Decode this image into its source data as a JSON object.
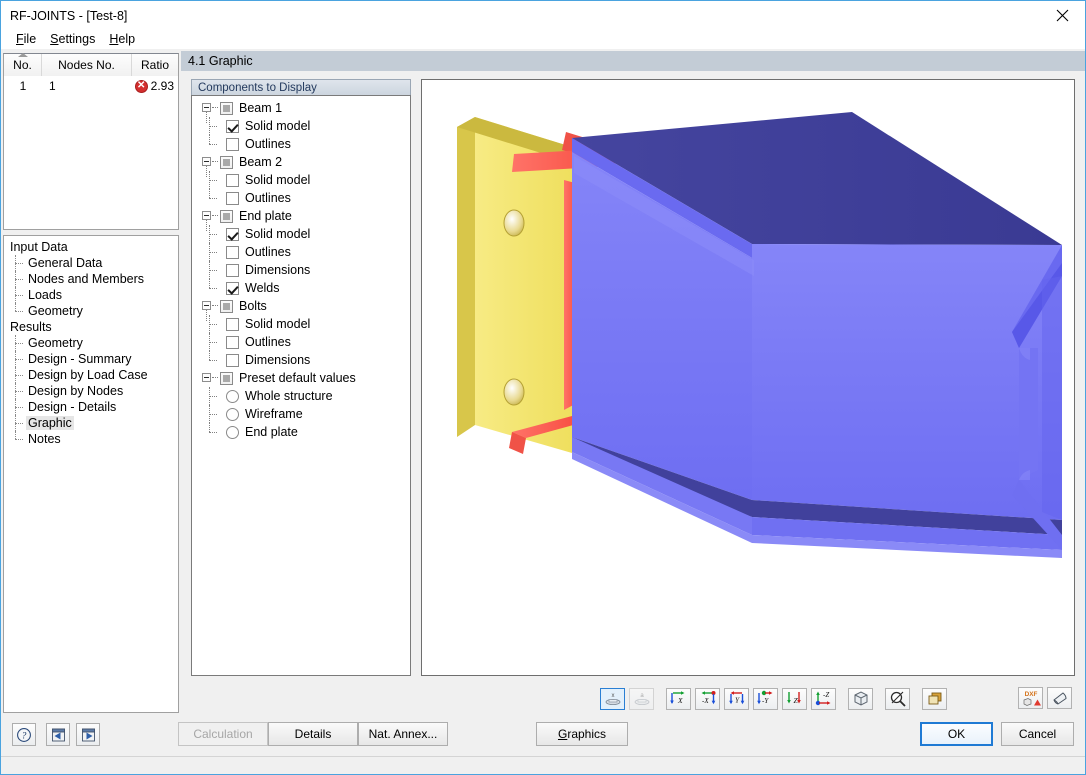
{
  "window": {
    "title": "RF-JOINTS - [Test-8]",
    "close_icon": "close-icon"
  },
  "menu": {
    "items": [
      {
        "label": "File",
        "accel": "F"
      },
      {
        "label": "Settings",
        "accel": "S"
      },
      {
        "label": "Help",
        "accel": "H"
      }
    ]
  },
  "results_table": {
    "columns": [
      "No.",
      "Nodes No.",
      "Ratio"
    ],
    "rows": [
      {
        "no": "1",
        "nodes_no": "1",
        "status_icon": "error-icon",
        "ratio": "2.93"
      }
    ]
  },
  "nav": {
    "groups": [
      {
        "label": "Input Data",
        "items": [
          {
            "label": "General Data",
            "selected": false
          },
          {
            "label": "Nodes and Members",
            "selected": false
          },
          {
            "label": "Loads",
            "selected": false
          },
          {
            "label": "Geometry",
            "selected": false
          }
        ]
      },
      {
        "label": "Results",
        "items": [
          {
            "label": "Geometry",
            "selected": false
          },
          {
            "label": "Design - Summary",
            "selected": false
          },
          {
            "label": "Design by Load Case",
            "selected": false
          },
          {
            "label": "Design by Nodes",
            "selected": false
          },
          {
            "label": "Design - Details",
            "selected": false
          },
          {
            "label": "Graphic",
            "selected": true
          },
          {
            "label": "Notes",
            "selected": false
          }
        ]
      }
    ]
  },
  "section": {
    "header": "4.1 Graphic"
  },
  "components": {
    "caption": "Components to Display",
    "tree": [
      {
        "label": "Beam 1",
        "state": "tristate",
        "children": [
          {
            "label": "Solid model",
            "type": "checkbox",
            "checked": true
          },
          {
            "label": "Outlines",
            "type": "checkbox",
            "checked": false
          }
        ]
      },
      {
        "label": "Beam 2",
        "state": "tristate",
        "children": [
          {
            "label": "Solid model",
            "type": "checkbox",
            "checked": false
          },
          {
            "label": "Outlines",
            "type": "checkbox",
            "checked": false
          }
        ]
      },
      {
        "label": "End plate",
        "state": "tristate",
        "children": [
          {
            "label": "Solid model",
            "type": "checkbox",
            "checked": true
          },
          {
            "label": "Outlines",
            "type": "checkbox",
            "checked": false
          },
          {
            "label": "Dimensions",
            "type": "checkbox",
            "checked": false
          },
          {
            "label": "Welds",
            "type": "checkbox",
            "checked": true
          }
        ]
      },
      {
        "label": "Bolts",
        "state": "tristate",
        "children": [
          {
            "label": "Solid model",
            "type": "checkbox",
            "checked": false
          },
          {
            "label": "Outlines",
            "type": "checkbox",
            "checked": false
          },
          {
            "label": "Dimensions",
            "type": "checkbox",
            "checked": false
          }
        ]
      },
      {
        "label": "Preset default values",
        "state": "tristate",
        "children": [
          {
            "label": "Whole structure",
            "type": "radio",
            "checked": false
          },
          {
            "label": "Wireframe",
            "type": "radio",
            "checked": false
          },
          {
            "label": "End plate",
            "type": "radio",
            "checked": false
          }
        ]
      }
    ]
  },
  "graphics_toolbar": {
    "buttons": [
      {
        "name": "render-solid-button",
        "icon": "solid-view-icon",
        "label": "x",
        "selected": true,
        "disabled": false
      },
      {
        "name": "render-wireframe-button",
        "icon": "wireframe-view-icon",
        "label": "a",
        "selected": false,
        "disabled": true
      },
      {
        "name": "view-x-button",
        "icon": "view-in-x-icon",
        "label": "X",
        "selected": false,
        "disabled": false
      },
      {
        "name": "view-neg-x-button",
        "icon": "view-against-x-icon",
        "label": "-X",
        "selected": false,
        "disabled": false
      },
      {
        "name": "view-y-button",
        "icon": "view-in-y-icon",
        "label": "Y",
        "selected": false,
        "disabled": false
      },
      {
        "name": "view-neg-y-button",
        "icon": "view-against-y-icon",
        "label": "-Y",
        "selected": false,
        "disabled": false
      },
      {
        "name": "view-z-button",
        "icon": "view-in-z-icon",
        "label": "Z",
        "selected": false,
        "disabled": false
      },
      {
        "name": "view-neg-z-button",
        "icon": "view-against-z-icon",
        "label": "-Z",
        "selected": false,
        "disabled": false
      },
      {
        "name": "isometric-view-button",
        "icon": "cube-isometric-icon",
        "label": "",
        "selected": false,
        "disabled": false
      },
      {
        "name": "zoom-all-button",
        "icon": "magnifier-icon",
        "label": "",
        "selected": false,
        "disabled": false
      },
      {
        "name": "render-mode-button",
        "icon": "layers-icon",
        "label": "",
        "selected": false,
        "disabled": false
      }
    ],
    "right_buttons": [
      {
        "name": "export-dxf-button",
        "icon": "dxf-export-icon",
        "label": "DXF"
      },
      {
        "name": "print-button",
        "icon": "printer-icon",
        "label": ""
      }
    ]
  },
  "bottom_bar": {
    "icon_buttons": [
      {
        "name": "help-button",
        "icon": "question-icon"
      },
      {
        "name": "previous-button",
        "icon": "arrow-left-icon"
      },
      {
        "name": "next-button",
        "icon": "arrow-right-icon"
      }
    ],
    "calculation_label": "Calculation",
    "details_label": "Details",
    "nat_annex_label": "Nat. Annex...",
    "graphics_label": "Graphics",
    "graphics_accel": "G",
    "ok_label": "OK",
    "cancel_label": "Cancel"
  },
  "colors": {
    "title_bar_border": "#4aa3df",
    "section_header": "#c3ccd6",
    "beam_face_light": "#7b7bf5",
    "beam_face_dark": "#3d3d9e",
    "end_plate": "#f2e46a",
    "end_plate_edge": "#c9b02c",
    "weld": "#fa5a50",
    "error_red": "#d32f2f",
    "focus_blue": "#1f7ad4"
  },
  "model": {
    "description": "3D solid model of a bolted end-plate beam-to-beam joint: yellow end plate with two bolt holes, red fillet welds, blue I-section beam"
  }
}
